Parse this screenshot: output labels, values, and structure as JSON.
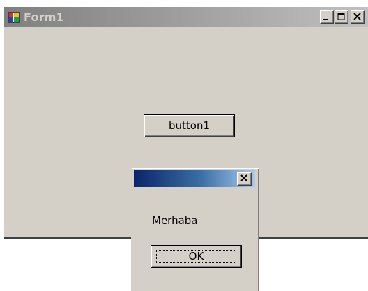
{
  "form": {
    "title": "Form1",
    "icon": "form-app-icon",
    "caption_buttons": [
      "minimize-icon",
      "maximize-icon",
      "close-icon"
    ],
    "button1_label": "button1"
  },
  "message_box": {
    "title": "",
    "message": "Merhaba",
    "ok_label": "OK",
    "close_icon": "close-icon"
  },
  "colors": {
    "window_face": "#d4d0c8",
    "inactive_title_start": "#808080",
    "inactive_title_end": "#c0c0c0",
    "active_title_start": "#0a246a",
    "active_title_end": "#a6caf0"
  }
}
